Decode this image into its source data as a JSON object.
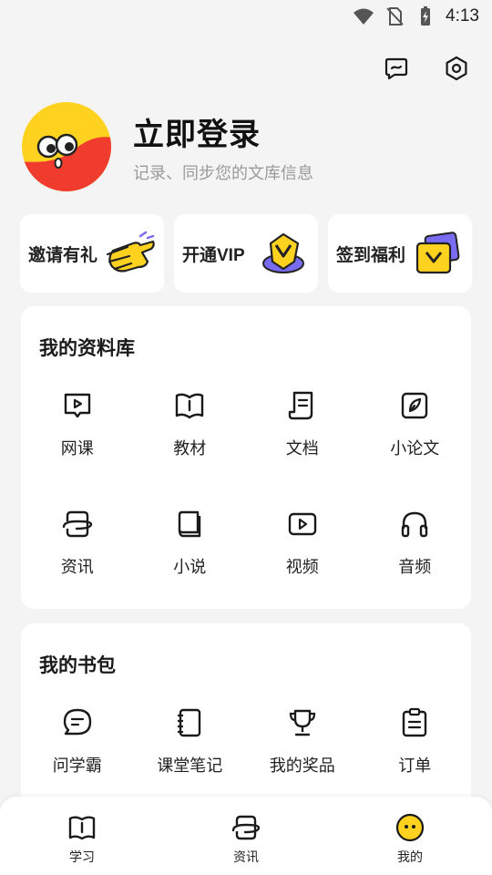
{
  "status_bar": {
    "time": "4:13",
    "icons": [
      "wifi-icon",
      "no-sim-icon",
      "battery-charging-icon"
    ]
  },
  "top_actions": {
    "icons": [
      "message-icon",
      "settings-icon"
    ]
  },
  "profile": {
    "title": "立即登录",
    "subtitle": "记录、同步您的文库信息",
    "avatar_colors": [
      "#ffd21f",
      "#f03c2e"
    ]
  },
  "quick_cards": [
    {
      "label": "邀请有礼",
      "icon": "waving-hand-icon"
    },
    {
      "label": "开通VIP",
      "icon": "vip-badge-icon"
    },
    {
      "label": "签到福利",
      "icon": "checkin-card-icon"
    }
  ],
  "library": {
    "title": "我的资料库",
    "items": [
      {
        "label": "网课",
        "icon": "online-course-icon"
      },
      {
        "label": "教材",
        "icon": "textbook-icon"
      },
      {
        "label": "文档",
        "icon": "document-icon"
      },
      {
        "label": "小论文",
        "icon": "essay-icon"
      },
      {
        "label": "资讯",
        "icon": "news-icon"
      },
      {
        "label": "小说",
        "icon": "novel-icon"
      },
      {
        "label": "视频",
        "icon": "video-icon"
      },
      {
        "label": "音频",
        "icon": "headphones-icon"
      }
    ]
  },
  "bag": {
    "title": "我的书包",
    "items": [
      {
        "label": "问学霸",
        "icon": "chat-icon"
      },
      {
        "label": "课堂笔记",
        "icon": "notebook-icon"
      },
      {
        "label": "我的奖品",
        "icon": "trophy-icon"
      },
      {
        "label": "订单",
        "icon": "clipboard-icon"
      }
    ]
  },
  "tabbar": {
    "tabs": [
      {
        "label": "学习",
        "icon": "book-icon"
      },
      {
        "label": "资讯",
        "icon": "planet-icon"
      },
      {
        "label": "我的",
        "icon": "face-icon"
      }
    ]
  },
  "colors": {
    "background": "#f4f4f4",
    "card": "#ffffff",
    "accent_yellow": "#ffd21f",
    "accent_red": "#f03c2e",
    "accent_purple": "#7a6cf0"
  }
}
